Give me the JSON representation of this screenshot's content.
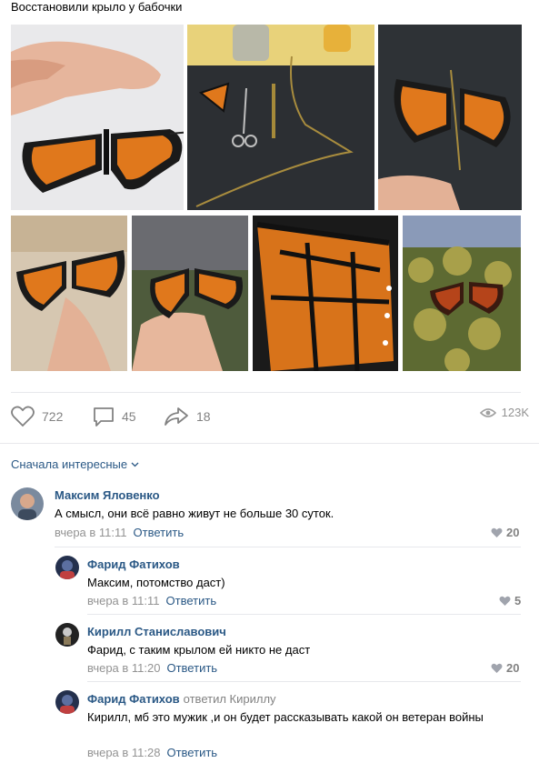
{
  "post": {
    "text": "Восстановили крыло у бабочки"
  },
  "photos": [
    {
      "name": "photo-hand-butterfly",
      "palette": "hand"
    },
    {
      "name": "photo-tools-on-towel",
      "palette": "tools"
    },
    {
      "name": "photo-butterfly-on-towel",
      "palette": "towel"
    },
    {
      "name": "photo-butterfly-on-finger",
      "palette": "finger"
    },
    {
      "name": "photo-butterfly-on-palm",
      "palette": "palm"
    },
    {
      "name": "photo-wing-closeup",
      "palette": "closeup"
    },
    {
      "name": "photo-butterfly-in-bush",
      "palette": "bush"
    }
  ],
  "actions": {
    "likes": "722",
    "comments": "45",
    "shares": "18",
    "views": "123K"
  },
  "sort": {
    "label": "Сначала интересные"
  },
  "comments": [
    {
      "author": "Максим Яловенко",
      "reply_to": "",
      "text": "А смысл, они всё равно живут не больше 30 суток.",
      "time": "вчера в 11:11",
      "reply_label": "Ответить",
      "likes": "20"
    },
    {
      "author": "Фарид Фатихов",
      "reply_to": "",
      "text": "Максим, потомство даст)",
      "time": "вчера в 11:11",
      "reply_label": "Ответить",
      "likes": "5"
    },
    {
      "author": "Кирилл Станиславович",
      "reply_to": "",
      "text": "Фарид, с таким крылом ей никто не даст",
      "time": "вчера в 11:20",
      "reply_label": "Ответить",
      "likes": "20"
    },
    {
      "author": "Фарид Фатихов",
      "reply_to": "ответил Кириллу",
      "text": "Кирилл, мб это мужик ,и он будет рассказывать какой он ветеран войны",
      "time": "вчера в 11:28",
      "reply_label": "Ответить",
      "likes": ""
    }
  ],
  "colors": {
    "link": "#2a5885",
    "meta": "#939393",
    "divider": "#e7e8ec",
    "monarch_orange": "#e0781c"
  }
}
